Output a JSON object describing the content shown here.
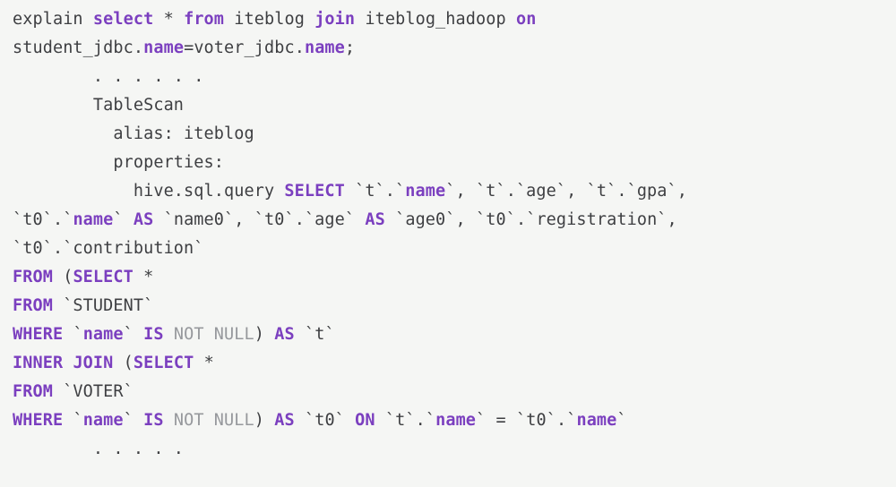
{
  "t": {
    "explain": "explain",
    "select": "select",
    "star1": " *",
    "from1": " from",
    "iteblog": " iteblog",
    "join1": " join",
    "iteblog_hadoop": " iteblog_hadoop",
    "on": " on",
    "student_jdbc": "student_jdbc",
    "dot1": ".",
    "name1": "name",
    "eq1": "=",
    "voter_jdbc": "voter_jdbc",
    "dot2": ".",
    "name2": "name",
    "semi": ";",
    "dots1": "        . . . . . .",
    "tablescan": "        TableScan",
    "alias": "          alias: iteblog",
    "properties": "          properties:",
    "hivequery": "            hive.sql.query",
    "SELECT1": " SELECT",
    "tname": " `t`.`",
    "name3": "name",
    "bq": "`",
    "comma": ",",
    "tage": " `t`.`age`",
    "tgpa": " `t`.`gpa`",
    "t0name_pre": "`t0`.`",
    "name4": "name",
    "AS1": " AS",
    "name0": " `name0`",
    "t0age": " `t0`.`age`",
    "AS2": " AS",
    "age0": " `age0`",
    "t0reg": " `t0`.`registration`",
    "t0contrib": "`t0`.`contribution`",
    "FROM2": "FROM",
    "lp": " (",
    "SELECT2": "SELECT",
    "star2": " *",
    "FROM3": "FROM",
    "student": " `STUDENT`",
    "WHERE1": "WHERE",
    "bname1": " `",
    "name5": "name",
    "bname1e": "`",
    "IS1": " IS",
    "NOTNULL1": " NOT NULL",
    "rp1": ")",
    "AS3": " AS",
    "t_alias": " `t`",
    "INNER": "INNER",
    "JOIN2": " JOIN",
    "lp2": " (",
    "SELECT3": "SELECT",
    "star3": " *",
    "FROM4": "FROM",
    "voter": " `VOTER`",
    "WHERE2": "WHERE",
    "bname2": " `",
    "name6": "name",
    "bname2e": "`",
    "IS2": " IS",
    "NOTNULL2": " NOT NULL",
    "rp2": ")",
    "AS4": " AS",
    "t0_alias": " `t0`",
    "ON2": " ON",
    "tdot": " `t`.`",
    "name7": "name",
    "bq2": "`",
    "eq2": " = ",
    "t0dot": "`t0`.`",
    "name8": "name",
    "bq3": "`",
    "dots2": "        . . . . ."
  }
}
